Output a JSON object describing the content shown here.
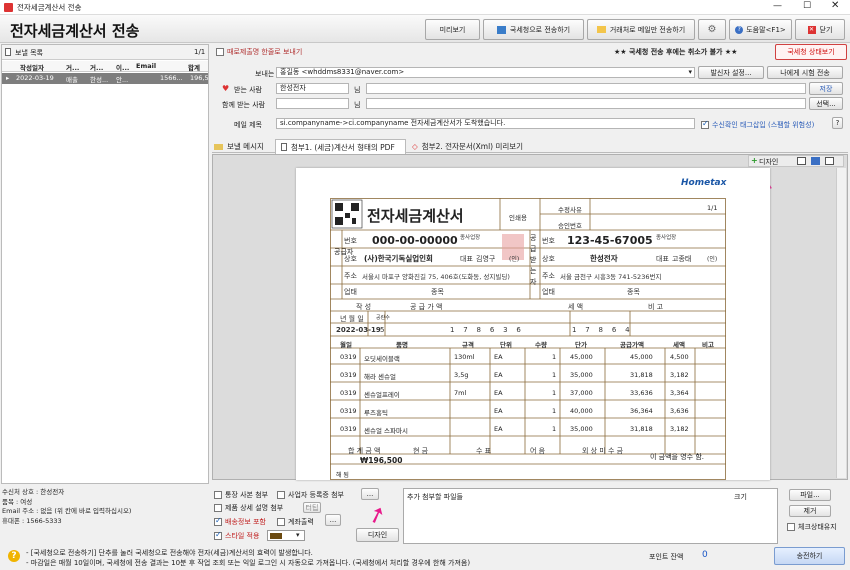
{
  "window": {
    "title": "전자세금계산서 전송"
  },
  "header": {
    "title": "전자세금계산서 전송",
    "buttons": [
      "미리보기",
      "국세청으로 전송하기",
      "거래처로 메일만 전송하기",
      "",
      "도움말<F1>",
      "닫기"
    ]
  },
  "left": {
    "panel_title": "보낼 목록",
    "page": "1/1",
    "columns": [
      "작성일자",
      "거...",
      "거...",
      "이...",
      "Email",
      "합계"
    ],
    "row": [
      "2022-03-19",
      "매출",
      "한성...",
      "안...",
      "",
      "1566...",
      "196,5"
    ],
    "info": [
      "수신처 상호 : 한성전자",
      "품목 : 여성",
      "Email 주소 : 없음 (위 칸에 바로 입력하십시오)",
      "휴대폰 : 1566-5333"
    ]
  },
  "topbar": {
    "send_copy": "때로제출명 한줄로 보내기",
    "warning": "★★ 국세청 전송 후에는 취소가 불가 ★★",
    "nts_status": "국세청 상태보기"
  },
  "form": {
    "sender_label": "보내는 사람",
    "sender_value": "홍길동 <whddms8331@naver.com>",
    "sender_settings": "발신자 설정...",
    "test_send": "나에게 시험 전송",
    "recipient_label": "받는 사람",
    "recipient_name": "한성전자",
    "honorific": "님",
    "save": "저장",
    "cc_label": "함께 받는 사람",
    "cc_honorific": "님",
    "select": "선택...",
    "subject_label": "메일 제목",
    "subject_value": "si.companyname->ci.companyname 전자세금계산서가 도착했습니다.",
    "read_receipt": "수신확인 태그삽입 (스팸할 위험성)",
    "help": "?"
  },
  "tabs": [
    "보낼 메시지",
    "첨부1. (세금)계산서 형태의 PDF",
    "첨부2. 전자문서(Xml) 미리보기"
  ],
  "preview": {
    "design_label": "디자인",
    "logo": "Hometax"
  },
  "invoice": {
    "title": "전자세금계산서",
    "purpose_left": "인쇄용",
    "mod_label": "수정사유",
    "approval_label": "승인번호",
    "page": "1/1",
    "supplier_vertical": "공급자",
    "buyer_vertical": "공급받는자",
    "reg_label": "번호",
    "jongsa": "종사업장",
    "supplier_reg": "000-00-00000",
    "buyer_reg": "123-45-67005",
    "name_label": "상호",
    "supplier_name": "(사)한국기독실업인회",
    "rep_label": "대표",
    "supplier_rep": "김영구",
    "seal": "(인)",
    "buyer_name": "한성전자",
    "buyer_rep": "고종태",
    "addr_label": "주소",
    "supplier_addr": "서울시 마포구 양화진길 75, 406호(도화동, 성지빌딩)",
    "buyer_addr": "서울 금천구 시흥3동 741-5236번지",
    "biz_label": "업태",
    "item_label": "종목",
    "header_labels": [
      "작 성",
      "공 급 가 액",
      "세 액",
      "비 고"
    ],
    "date_labels": [
      "년 월 일",
      "공란수"
    ],
    "digits_label": [
      "백",
      "십",
      "억",
      "천",
      "백",
      "십",
      "만",
      "천",
      "백",
      "십",
      "일"
    ],
    "write_date": "2022-03-19",
    "blank_count": "5",
    "supply_digits": "1 7 8 6 3 6",
    "tax_digits": "1 7 8 6 4",
    "items_head": [
      "월일",
      "품명",
      "규격",
      "단위",
      "수량",
      "단가",
      "공급가액",
      "세액",
      "비고"
    ],
    "items": [
      [
        "0319",
        "오딧세이블랙",
        "130ml",
        "EA",
        "1",
        "45,000",
        "45,000",
        "4,500"
      ],
      [
        "0319",
        "해라 센슈얼",
        "3,5g",
        "EA",
        "1",
        "35,000",
        "31,818",
        "3,182"
      ],
      [
        "0319",
        "센슈얼프레이",
        "7ml",
        "EA",
        "1",
        "37,000",
        "33,636",
        "3,364"
      ],
      [
        "0319",
        "루즈홍틱",
        "",
        "EA",
        "1",
        "40,000",
        "36,364",
        "3,636"
      ],
      [
        "0319",
        "센슈얼 스파마시",
        "",
        "EA",
        "1",
        "35,000",
        "31,818",
        "3,182"
      ]
    ],
    "total_labels": [
      "합 계 금 액",
      "현 금",
      "수 표",
      "어 음",
      "외 상 미 수 금"
    ],
    "total_amount": "₩196,500",
    "receipt": "이 금액을 영수 함.",
    "bottom_partial": "해 됨"
  },
  "bottom": {
    "checks": [
      "통장 사본 첨부",
      "제품 상세 설명 첨부",
      "배송정보 포함",
      "스타일 적용"
    ],
    "checks2": [
      "사업자 등록증 첨부",
      "계좌출력"
    ],
    "ellipsis": "...",
    "gift": "터팁",
    "design_button": "디자인",
    "attach_header": "추가 첨부할 파일들",
    "size_header": "크기",
    "file_button": "파일...",
    "remove_button": "제거",
    "sync_check": "체크상태유지",
    "point_label": "포인트 잔액",
    "point_value": "0",
    "send_button": "송전하기"
  },
  "notice": {
    "line1": "- [국세청으로 전송하기] 단추를 눌러 국세청으로 전송해야 전자(세금)계산서의 효력이 발생합니다.",
    "line2": "- 마감일은 매월 10일이며, 국세청에 전송 결과는 10분 후 작업 조회 또는 익일 로그인 시 자동으로 가져옵니다. (국세청에서 처리할 경우에 한해 가져옴)"
  }
}
